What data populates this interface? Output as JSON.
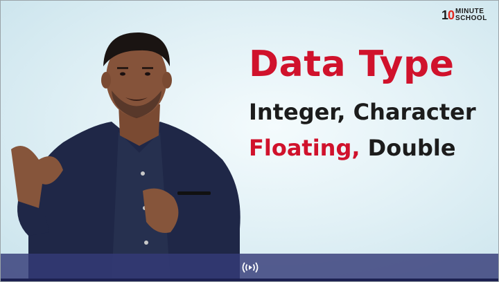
{
  "logo": {
    "number_one": "1",
    "number_zero": "0",
    "line1": "MINUTE",
    "line2": "SCHOOL"
  },
  "slide": {
    "title": "Data Type",
    "line1": "Integer, Character",
    "line2_red": "Floating,",
    "line2_dark": "Double"
  },
  "colors": {
    "accent_red": "#d0122c",
    "text_dark": "#1c1c1c",
    "bar": "#343a78"
  },
  "controls": {
    "icon": "live-broadcast-icon"
  }
}
